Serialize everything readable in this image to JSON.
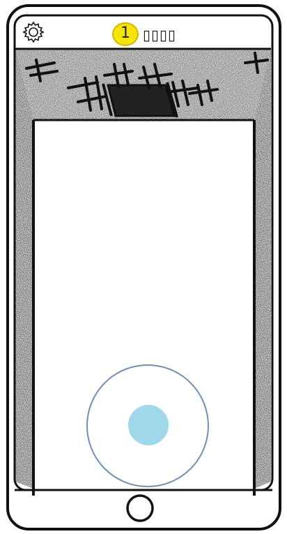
{
  "status": {
    "level_badge": "1",
    "level_label": "▯▯▯▯"
  },
  "icons": {
    "settings": "gear-icon",
    "home": "home-button-icon"
  },
  "joystick": {
    "ring_color": "#6f8fb8",
    "knob_color": "#9fd8ea"
  },
  "colors": {
    "badge_fill": "#f5e600",
    "badge_stroke": "#d8b400",
    "outline": "#111111"
  }
}
